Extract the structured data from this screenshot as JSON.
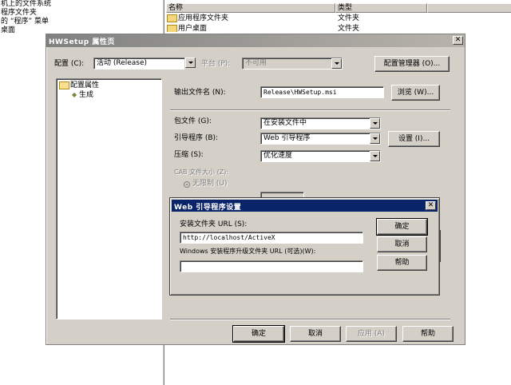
{
  "explorer": {
    "tree_items": [
      "机上的文件系统",
      "程序文件夹",
      "的 “程序” 菜单",
      "桌面"
    ],
    "columns": [
      "名称",
      "类型"
    ],
    "rows": [
      {
        "name": "应用程序文件夹",
        "type": "文件夹"
      },
      {
        "name": "用户桌面",
        "type": "文件夹"
      }
    ]
  },
  "dialog": {
    "title": "HWSetup 属性页",
    "close_label": "✕",
    "config_label": "配置 (C):",
    "config_value": "活动 (Release)",
    "platform_label": "平台 (P):",
    "platform_value": "不可用",
    "config_manager_label": "配置管理器 (O)...",
    "tree": {
      "root": "配置属性",
      "child": "生成"
    },
    "output_label": "输出文件名 (N):",
    "output_value": "Release\\HWSetup.msi",
    "browse_label": "浏览 (W)...",
    "package_label": "包文件 (G):",
    "package_value": "在安装文件中",
    "bootstrapper_label": "引导程序 (B):",
    "bootstrapper_value": "Web 引导程序",
    "settings_label": "设置 (I)...",
    "compression_label": "压缩 (S):",
    "compression_value": "优化速度",
    "cab_label": "CAB 文件大小 (Z):",
    "cab_unlimited_label": "无限制 (U)",
    "ok_label": "确定",
    "cancel_label": "取消",
    "apply_label": "应用 (A)",
    "help_label": "帮助"
  },
  "web_dialog": {
    "title": "Web 引导程序设置",
    "close_label": "✕",
    "install_url_label": "安装文件夹 URL (S):",
    "install_url_value": "http://localhost/ActiveX",
    "upgrade_url_label": "Windows 安装程序升级文件夹 URL (可选)(W):",
    "upgrade_url_value": "",
    "ok_label": "确定",
    "cancel_label": "取消",
    "help_label": "帮助"
  },
  "colors": {
    "dialog_bg": "#d4d0c8",
    "title_active": "#0a246a",
    "title_inactive": "#808080"
  }
}
